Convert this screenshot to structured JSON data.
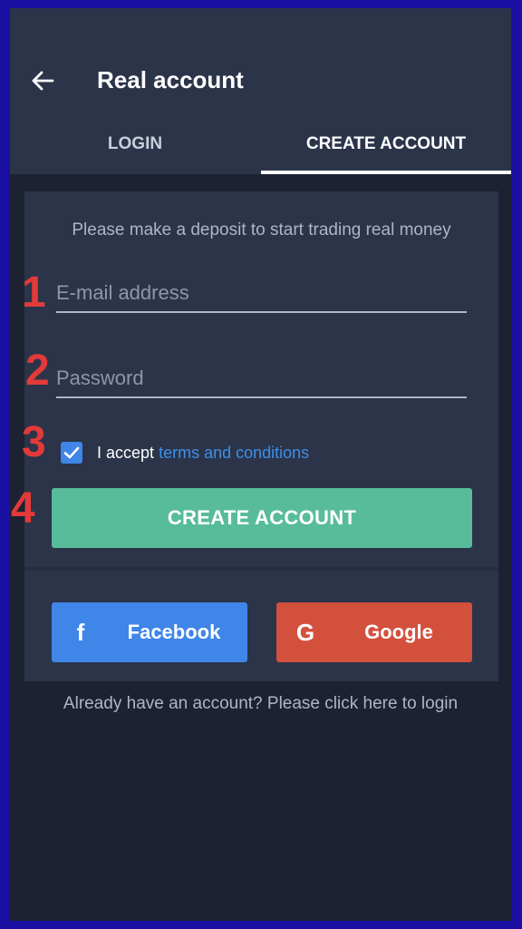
{
  "header": {
    "title": "Real account"
  },
  "tabs": [
    {
      "label": "LOGIN",
      "active": false
    },
    {
      "label": "CREATE ACCOUNT",
      "active": true
    }
  ],
  "form": {
    "subtitle": "Please make a deposit to start trading real money",
    "email_placeholder": "E-mail address",
    "email_value": "",
    "password_placeholder": "Password",
    "password_value": "",
    "accept_checked": true,
    "accept_prefix": "I accept",
    "terms_link": "terms and conditions",
    "create_button": "CREATE ACCOUNT"
  },
  "social": {
    "facebook_icon": "f",
    "facebook_label": "Facebook",
    "google_icon": "G",
    "google_label": "Google"
  },
  "footer": {
    "login_hint": "Already have an account? Please click here to login"
  },
  "annotations": [
    "1",
    "2",
    "3",
    "4"
  ],
  "colors": {
    "accent_green": "#58bc9a",
    "facebook_blue": "#3f86e8",
    "google_red": "#d3503d",
    "annotation_red": "#e23a3a",
    "background": "#1c2232",
    "surface": "#2b3449"
  }
}
